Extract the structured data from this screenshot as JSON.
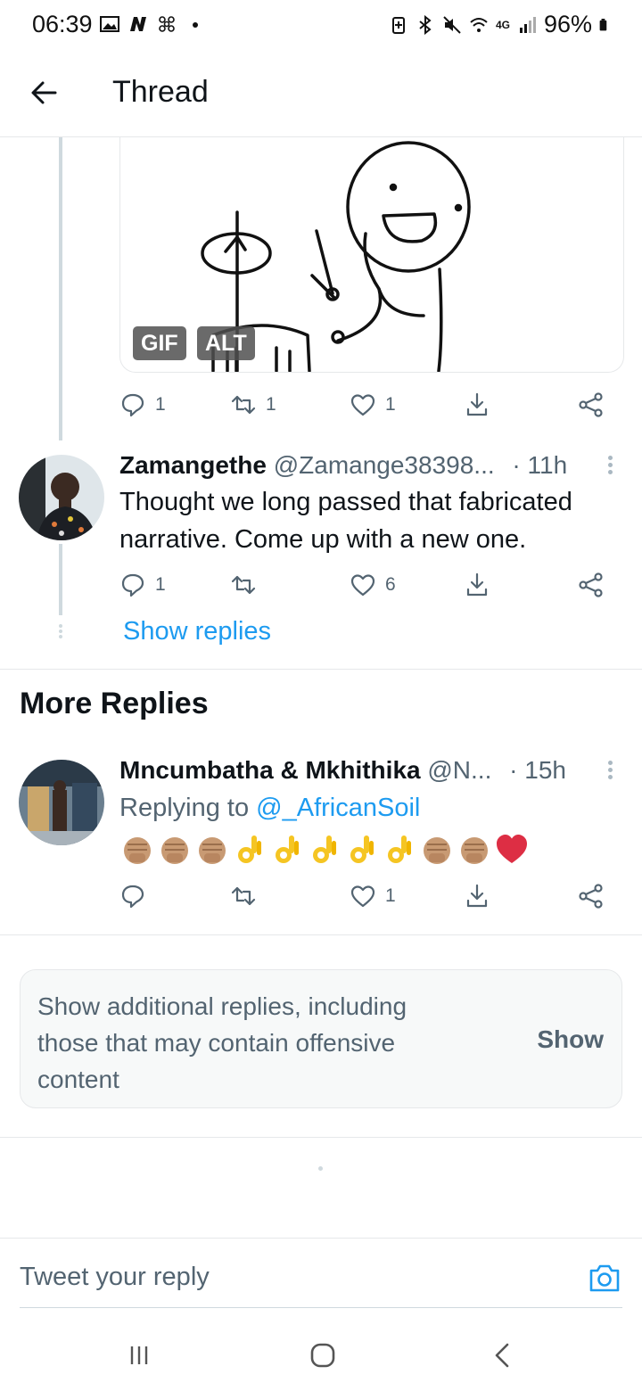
{
  "status_bar": {
    "time": "06:39",
    "battery": "96%",
    "network": "4G",
    "left_icons": [
      "gallery-icon",
      "n-icon",
      "fan-icon",
      "dot-icon"
    ],
    "right_icons": [
      "battery-saver-icon",
      "bluetooth-icon",
      "mute-icon",
      "wifi-icon",
      "signal-icon",
      "battery-icon"
    ]
  },
  "header": {
    "title": "Thread",
    "back_icon": "arrow-left-icon"
  },
  "gif_card": {
    "gif_badge": "GIF",
    "alt_badge": "ALT"
  },
  "tweet_1_actions": {
    "replies": "1",
    "retweets": "1",
    "likes": "1"
  },
  "tweet_2": {
    "name": "Zamangethe",
    "handle": "@Zamange38398...",
    "time": "· 11h",
    "text": "Thought we long passed that fabricated narrative. Come up with a new one.",
    "replies": "1",
    "retweets": "",
    "likes": "6"
  },
  "show_replies": "Show replies",
  "more_replies_title": "More Replies",
  "tweet_3": {
    "name": "Mncumbatha & Mkhithika",
    "handle": "@N...",
    "time": "· 15h",
    "replying_prefix": "Replying to ",
    "replying_to": "@_AfricanSoil",
    "emojis": [
      "fist",
      "fist",
      "fist",
      "ok",
      "ok",
      "ok",
      "ok",
      "ok",
      "fist",
      "fist",
      "heart"
    ],
    "replies": "",
    "retweets": "",
    "likes": "1"
  },
  "additional_replies": {
    "text": "Show additional replies, including those that may contain offensive content",
    "button": "Show"
  },
  "composer": {
    "placeholder": "Tweet your reply",
    "camera_icon": "camera-icon"
  },
  "nav_bar": {
    "buttons": [
      "recents-icon",
      "home-icon",
      "back-icon"
    ]
  },
  "colors": {
    "accent": "#1d9bf0",
    "secondary_text": "#536471",
    "heart": "#e0245e"
  }
}
